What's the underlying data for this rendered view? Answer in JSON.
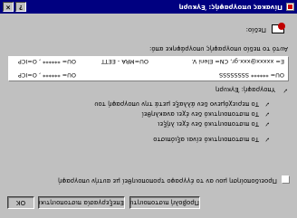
{
  "window": {
    "title": "Πίνακας υπογραφής: Έγκυρη",
    "controls": {
      "help": "?",
      "close": "×"
    }
  },
  "signed_field": {
    "label": "Πεδίο:",
    "value": ""
  },
  "certificate": {
    "section_label": "Αυτό το πεδίο υπογραφής υπογράφηκε από:",
    "line1": "E= xxxxx@xxx.gr, CN= Eleni V., OU=MRA - EETT, OU= ***** , O=ICP",
    "line2_left": "OU= ****** SSSSSSSS",
    "line2_right": "OU= ****** , O=ICP",
    "line1_left": "E= xxxxx@xxx.gr, CN= Eleni V.",
    "line1_mid": "OU=MRA - EETT",
    "line1_right": "OU= ****** , O=ICP"
  },
  "status": {
    "heading": "Υπογραφή: Έγκυρη",
    "items": [
      "Το πιστοποιητικό είναι αξιόπιστο",
      "Το πιστοποιητικό δεν έχει λήξει",
      "Το πιστοποιητικό δεν έχει ανακληθεί",
      "Το περιεχόμενο δεν άλλαξε μετά την υπογραφή του"
    ]
  },
  "checkbox": {
    "label": "Προειδοποίηση μου αν το έγγραφο τροποποιηθεί με αυτήν υπογραφή",
    "checked": false
  },
  "buttons": {
    "view_certificate": "Προβολή πιστοποιητικού...",
    "edit_certificate": "Επεξεργασία πιστοποιητικού...",
    "ok": "OK"
  }
}
